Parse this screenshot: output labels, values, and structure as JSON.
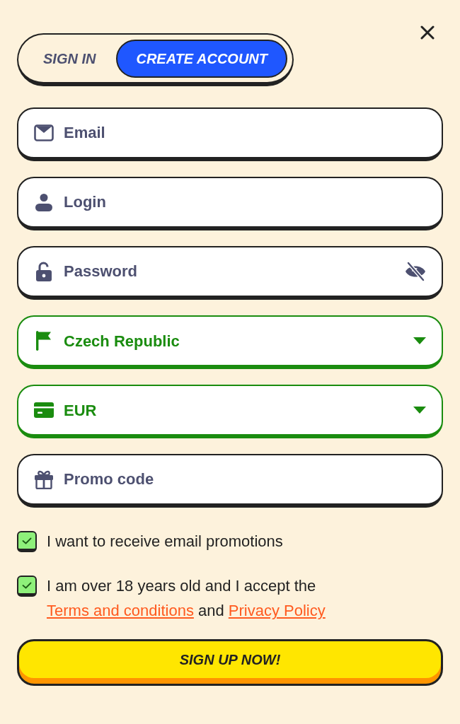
{
  "tabs": [
    {
      "label": "SIGN IN",
      "selected": false
    },
    {
      "label": "CREATE ACCOUNT",
      "selected": true
    }
  ],
  "fields": [
    {
      "kind": "email",
      "placeholder": "Email",
      "valid": false
    },
    {
      "kind": "login",
      "placeholder": "Login",
      "valid": false
    },
    {
      "kind": "password",
      "placeholder": "Password",
      "valid": false,
      "revealed": false
    },
    {
      "kind": "country",
      "value": "Czech Republic",
      "valid": true
    },
    {
      "kind": "currency",
      "value": "EUR",
      "valid": true
    },
    {
      "kind": "promo",
      "placeholder": "Promo code",
      "valid": false
    }
  ],
  "checkboxes": [
    {
      "checked": true,
      "parts": [
        {
          "kind": "text",
          "text": "I want to receive email promotions"
        }
      ]
    },
    {
      "checked": true,
      "parts": [
        {
          "kind": "text",
          "text": "I am over 18 years old and I accept the "
        },
        {
          "kind": "link",
          "text": "Terms and conditions"
        },
        {
          "kind": "text",
          "text": " and "
        },
        {
          "kind": "link",
          "text": "Privacy Policy"
        }
      ]
    }
  ],
  "submit": {
    "label": "SIGN UP NOW!"
  }
}
